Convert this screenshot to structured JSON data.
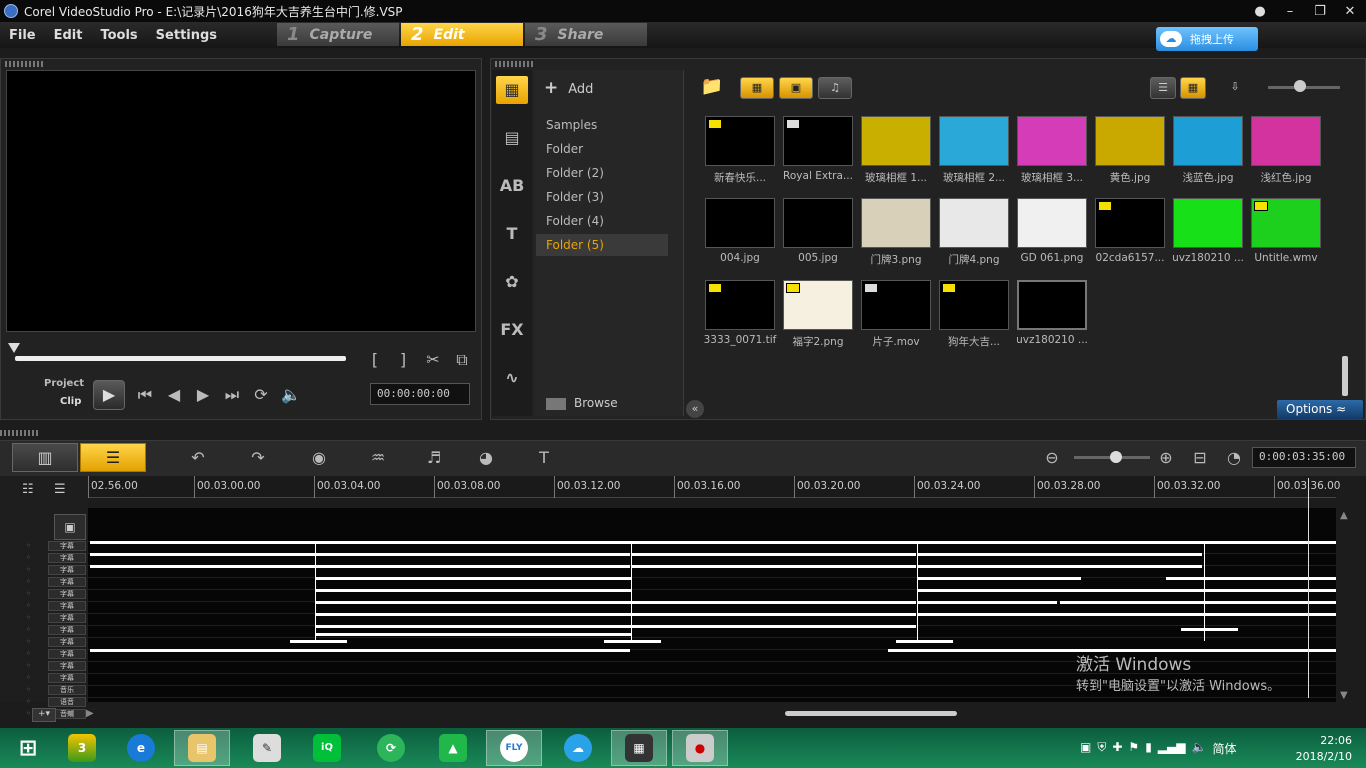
{
  "window": {
    "title": "Corel VideoStudio Pro - E:\\记录片\\2016狗年大吉养生台中门.修.VSP"
  },
  "menu": {
    "file": "File",
    "edit": "Edit",
    "tools": "Tools",
    "settings": "Settings"
  },
  "steps": [
    {
      "num": "1",
      "label": "Capture",
      "active": false
    },
    {
      "num": "2",
      "label": "Edit",
      "active": true
    },
    {
      "num": "3",
      "label": "Share",
      "active": false
    }
  ],
  "cloud": {
    "label": "拖拽上传"
  },
  "player": {
    "project_label": "Project",
    "clip_label": "Clip",
    "timecode": "00:00:00:00"
  },
  "library": {
    "add_label": "Add",
    "folders": [
      "Samples",
      "Folder",
      "Folder (2)",
      "Folder (3)",
      "Folder (4)",
      "Folder (5)"
    ],
    "active_folder": "Folder (5)",
    "browse_label": "Browse",
    "options_label": "Options",
    "thumbnails": [
      {
        "label": "新春快乐...",
        "kind": "video",
        "bg": "#000000"
      },
      {
        "label": "Royal Extra...",
        "kind": "audio",
        "bg": "#000000"
      },
      {
        "label": "玻璃相框 1...",
        "kind": "image",
        "bg": "#c9b000"
      },
      {
        "label": "玻璃相框 2...",
        "kind": "image",
        "bg": "#2aa9d8"
      },
      {
        "label": "玻璃相框 3...",
        "kind": "image",
        "bg": "#d53cb8"
      },
      {
        "label": "黄色.jpg",
        "kind": "image",
        "bg": "#c9a800"
      },
      {
        "label": "浅蓝色.jpg",
        "kind": "image",
        "bg": "#1d9fd6"
      },
      {
        "label": "浅红色.jpg",
        "kind": "image",
        "bg": "#d2339e"
      },
      {
        "label": "004.jpg",
        "kind": "image",
        "bg": "#000000"
      },
      {
        "label": "005.jpg",
        "kind": "image",
        "bg": "#000000"
      },
      {
        "label": "门牌3.png",
        "kind": "image",
        "bg": "#d8d0b8"
      },
      {
        "label": "门牌4.png",
        "kind": "image",
        "bg": "#e8e8e8"
      },
      {
        "label": "GD 061.png",
        "kind": "image",
        "bg": "#f0f0f0"
      },
      {
        "label": "02cda6157...",
        "kind": "video",
        "bg": "#000000"
      },
      {
        "label": "uvz180210 ...",
        "kind": "image",
        "bg": "#18e018"
      },
      {
        "label": "Untitle.wmv",
        "kind": "video",
        "bg": "#1ed01e"
      },
      {
        "label": "3333_0071.tif",
        "kind": "video",
        "bg": "#000000"
      },
      {
        "label": "福字2.png",
        "kind": "video",
        "bg": "#f5f0e0"
      },
      {
        "label": "片子.mov",
        "kind": "audio",
        "bg": "#000000"
      },
      {
        "label": "狗年大吉...",
        "kind": "video",
        "bg": "#000000"
      },
      {
        "label": "uvz180210 ...",
        "kind": "image",
        "bg": "#000000"
      }
    ]
  },
  "timeline": {
    "timecode": "0:00:03:35:00",
    "ruler": [
      "02.56.00",
      "00.03.00.00",
      "00.03.04.00",
      "00.03.08.00",
      "00.03.12.00",
      "00.03.16.00",
      "00.03.20.00",
      "00.03.24.00",
      "00.03.28.00",
      "00.03.32.00",
      "00.03.36.00"
    ],
    "track_labels": [
      "字幕",
      "字幕",
      "字幕",
      "字幕",
      "字幕",
      "字幕",
      "字幕",
      "字幕",
      "字幕",
      "字幕",
      "字幕",
      "字幕",
      "音乐",
      "语音",
      "音效"
    ]
  },
  "watermark": {
    "line1": "激活 Windows",
    "line2": "转到\"电脑设置\"以激活 Windows。"
  },
  "taskbar": {
    "apps": [
      "windows-start",
      "app-360",
      "internet-explorer",
      "file-explorer",
      "notepad",
      "iqiyi",
      "app-refresh",
      "app-green",
      "iflytek",
      "baidu-cloud",
      "videostudio",
      "remote"
    ],
    "tray_lang": "简体",
    "time": "22:06",
    "date": "2018/2/10"
  },
  "colors": {
    "accent": "#f5b800",
    "options": "#1d5291",
    "taskbar": "#127a4c"
  }
}
